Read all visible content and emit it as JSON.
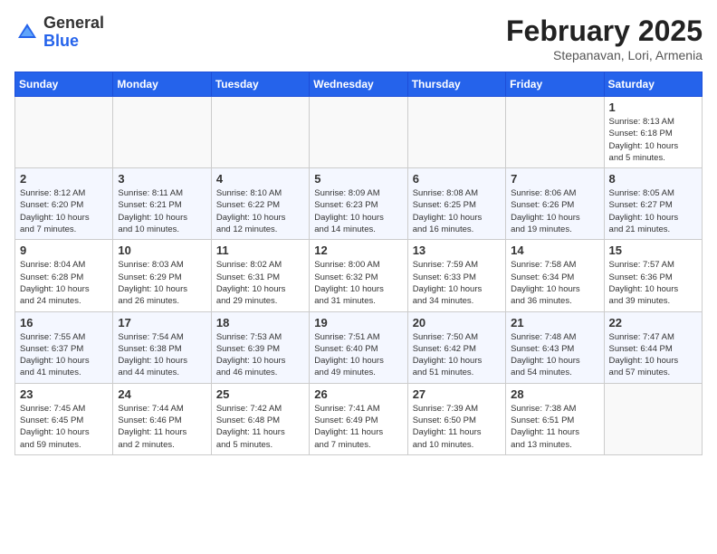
{
  "header": {
    "logo": {
      "general": "General",
      "blue": "Blue"
    },
    "title": "February 2025",
    "subtitle": "Stepanavan, Lori, Armenia"
  },
  "weekdays": [
    "Sunday",
    "Monday",
    "Tuesday",
    "Wednesday",
    "Thursday",
    "Friday",
    "Saturday"
  ],
  "weeks": [
    [
      {
        "day": "",
        "detail": ""
      },
      {
        "day": "",
        "detail": ""
      },
      {
        "day": "",
        "detail": ""
      },
      {
        "day": "",
        "detail": ""
      },
      {
        "day": "",
        "detail": ""
      },
      {
        "day": "",
        "detail": ""
      },
      {
        "day": "1",
        "detail": "Sunrise: 8:13 AM\nSunset: 6:18 PM\nDaylight: 10 hours\nand 5 minutes."
      }
    ],
    [
      {
        "day": "2",
        "detail": "Sunrise: 8:12 AM\nSunset: 6:20 PM\nDaylight: 10 hours\nand 7 minutes."
      },
      {
        "day": "3",
        "detail": "Sunrise: 8:11 AM\nSunset: 6:21 PM\nDaylight: 10 hours\nand 10 minutes."
      },
      {
        "day": "4",
        "detail": "Sunrise: 8:10 AM\nSunset: 6:22 PM\nDaylight: 10 hours\nand 12 minutes."
      },
      {
        "day": "5",
        "detail": "Sunrise: 8:09 AM\nSunset: 6:23 PM\nDaylight: 10 hours\nand 14 minutes."
      },
      {
        "day": "6",
        "detail": "Sunrise: 8:08 AM\nSunset: 6:25 PM\nDaylight: 10 hours\nand 16 minutes."
      },
      {
        "day": "7",
        "detail": "Sunrise: 8:06 AM\nSunset: 6:26 PM\nDaylight: 10 hours\nand 19 minutes."
      },
      {
        "day": "8",
        "detail": "Sunrise: 8:05 AM\nSunset: 6:27 PM\nDaylight: 10 hours\nand 21 minutes."
      }
    ],
    [
      {
        "day": "9",
        "detail": "Sunrise: 8:04 AM\nSunset: 6:28 PM\nDaylight: 10 hours\nand 24 minutes."
      },
      {
        "day": "10",
        "detail": "Sunrise: 8:03 AM\nSunset: 6:29 PM\nDaylight: 10 hours\nand 26 minutes."
      },
      {
        "day": "11",
        "detail": "Sunrise: 8:02 AM\nSunset: 6:31 PM\nDaylight: 10 hours\nand 29 minutes."
      },
      {
        "day": "12",
        "detail": "Sunrise: 8:00 AM\nSunset: 6:32 PM\nDaylight: 10 hours\nand 31 minutes."
      },
      {
        "day": "13",
        "detail": "Sunrise: 7:59 AM\nSunset: 6:33 PM\nDaylight: 10 hours\nand 34 minutes."
      },
      {
        "day": "14",
        "detail": "Sunrise: 7:58 AM\nSunset: 6:34 PM\nDaylight: 10 hours\nand 36 minutes."
      },
      {
        "day": "15",
        "detail": "Sunrise: 7:57 AM\nSunset: 6:36 PM\nDaylight: 10 hours\nand 39 minutes."
      }
    ],
    [
      {
        "day": "16",
        "detail": "Sunrise: 7:55 AM\nSunset: 6:37 PM\nDaylight: 10 hours\nand 41 minutes."
      },
      {
        "day": "17",
        "detail": "Sunrise: 7:54 AM\nSunset: 6:38 PM\nDaylight: 10 hours\nand 44 minutes."
      },
      {
        "day": "18",
        "detail": "Sunrise: 7:53 AM\nSunset: 6:39 PM\nDaylight: 10 hours\nand 46 minutes."
      },
      {
        "day": "19",
        "detail": "Sunrise: 7:51 AM\nSunset: 6:40 PM\nDaylight: 10 hours\nand 49 minutes."
      },
      {
        "day": "20",
        "detail": "Sunrise: 7:50 AM\nSunset: 6:42 PM\nDaylight: 10 hours\nand 51 minutes."
      },
      {
        "day": "21",
        "detail": "Sunrise: 7:48 AM\nSunset: 6:43 PM\nDaylight: 10 hours\nand 54 minutes."
      },
      {
        "day": "22",
        "detail": "Sunrise: 7:47 AM\nSunset: 6:44 PM\nDaylight: 10 hours\nand 57 minutes."
      }
    ],
    [
      {
        "day": "23",
        "detail": "Sunrise: 7:45 AM\nSunset: 6:45 PM\nDaylight: 10 hours\nand 59 minutes."
      },
      {
        "day": "24",
        "detail": "Sunrise: 7:44 AM\nSunset: 6:46 PM\nDaylight: 11 hours\nand 2 minutes."
      },
      {
        "day": "25",
        "detail": "Sunrise: 7:42 AM\nSunset: 6:48 PM\nDaylight: 11 hours\nand 5 minutes."
      },
      {
        "day": "26",
        "detail": "Sunrise: 7:41 AM\nSunset: 6:49 PM\nDaylight: 11 hours\nand 7 minutes."
      },
      {
        "day": "27",
        "detail": "Sunrise: 7:39 AM\nSunset: 6:50 PM\nDaylight: 11 hours\nand 10 minutes."
      },
      {
        "day": "28",
        "detail": "Sunrise: 7:38 AM\nSunset: 6:51 PM\nDaylight: 11 hours\nand 13 minutes."
      },
      {
        "day": "",
        "detail": ""
      }
    ]
  ]
}
